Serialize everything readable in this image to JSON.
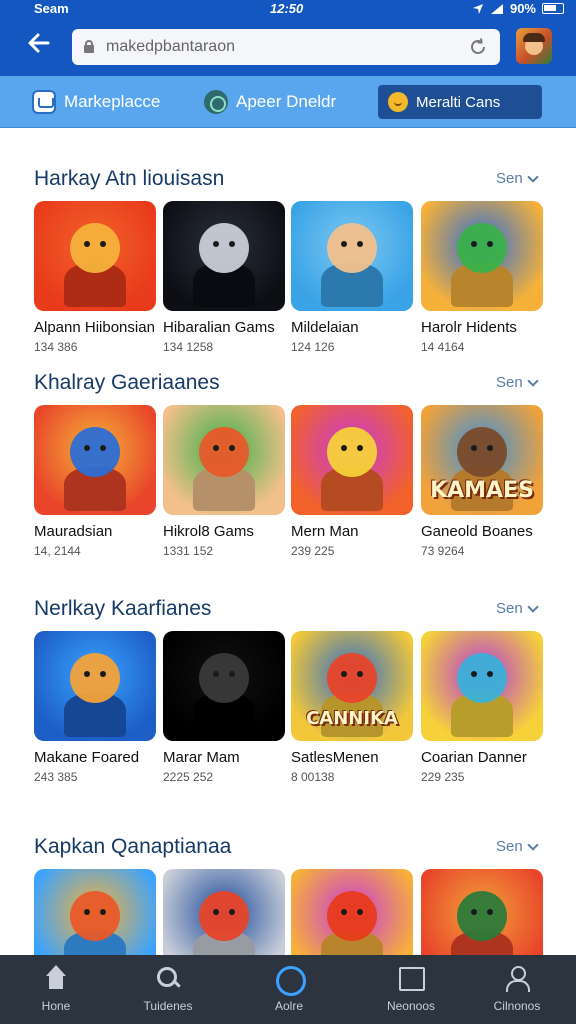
{
  "status_bar": {
    "carrier": "Seam",
    "time": "12:50",
    "battery": "90%"
  },
  "browser": {
    "url": "makedpbantaraon"
  },
  "tabs": [
    {
      "label": "Markeplacce",
      "icon": "marketplace-icon"
    },
    {
      "label": "Apeer Dneldr",
      "icon": "apex-icon"
    },
    {
      "label": "Meralti Cans",
      "icon": "meta-icon"
    }
  ],
  "sections": [
    {
      "title": "Harkay Atn liouisasn",
      "more": "Sen",
      "games": [
        {
          "title": "Alpann Hiibonsian",
          "meta": "134 386",
          "colors": [
            "#f2622a",
            "#e83b1b",
            "#f6b13a"
          ]
        },
        {
          "title": "Hibaralian Gams",
          "meta": "134 1258",
          "colors": [
            "#2a2f3b",
            "#0d0f15",
            "#c9ced8"
          ]
        },
        {
          "title": "Mildelaian",
          "meta": "124 126",
          "colors": [
            "#7cc8f2",
            "#3aa3e6",
            "#f2c08a"
          ]
        },
        {
          "title": "Harolr Hidents",
          "meta": "14 4164",
          "colors": [
            "#2d6ed4",
            "#f6b13a",
            "#3bb04a"
          ]
        }
      ]
    },
    {
      "title": "Khalray Gaeriaanes",
      "more": "Sen",
      "games": [
        {
          "title": "Mauradsian",
          "meta": "14, 2144",
          "colors": [
            "#f6b13a",
            "#e8452a",
            "#2d6ed4"
          ]
        },
        {
          "title": "Hikrol8 Gams",
          "meta": "1331 152",
          "colors": [
            "#3bb04a",
            "#f2c08a",
            "#e85a2a"
          ]
        },
        {
          "title": "Mern Man",
          "meta": "239 225",
          "colors": [
            "#c73ad8",
            "#f2622a",
            "#f6d13a"
          ]
        },
        {
          "title": "Ganeold Boanes",
          "meta": "73 9264",
          "colors": [
            "#3a8ed8",
            "#f2a23a",
            "#7a4a2a"
          ]
        }
      ],
      "caption": "KAMAES"
    },
    {
      "title": "Nerlkay Kaarfianes",
      "more": "Sen",
      "games": [
        {
          "title": "Makane Foared",
          "meta": "243 385",
          "colors": [
            "#3aa3ff",
            "#1d5fc7",
            "#f2a23a"
          ]
        },
        {
          "title": "Marar Mam",
          "meta": "2225 252",
          "colors": [
            "#111111",
            "#000000",
            "#3a3a3a"
          ]
        },
        {
          "title": "SatlesMenen",
          "meta": "8 00138",
          "colors": [
            "#2f6cc8",
            "#f2c83a",
            "#e8452a"
          ]
        },
        {
          "title": "Coarian Danner",
          "meta": "229 235",
          "colors": [
            "#b23ad8",
            "#f6d13a",
            "#3bb0d8"
          ]
        }
      ],
      "caption": "CANNIKA"
    },
    {
      "title": "Kapkan Qanaptianaa",
      "more": "Sen",
      "games": [
        {
          "title": "",
          "meta": "",
          "colors": [
            "#f6b13a",
            "#3aa3ff",
            "#e85a2a"
          ]
        },
        {
          "title": "",
          "meta": "",
          "colors": [
            "#1d4a9a",
            "#c9ced8",
            "#e8452a"
          ]
        },
        {
          "title": "",
          "meta": "",
          "colors": [
            "#c73ad8",
            "#f6b13a",
            "#e83b1b"
          ]
        },
        {
          "title": "",
          "meta": "",
          "colors": [
            "#f2a23a",
            "#e8452a",
            "#2d7a3a"
          ]
        }
      ]
    }
  ],
  "bottom_nav": [
    {
      "label": "Hone",
      "icon": "home-icon"
    },
    {
      "label": "Tuidenes",
      "icon": "search-icon"
    },
    {
      "label": "Aolre",
      "icon": "circle-icon"
    },
    {
      "label": "Neonoos",
      "icon": "square-icon"
    },
    {
      "label": "Cilnonos",
      "icon": "user-icon"
    }
  ]
}
